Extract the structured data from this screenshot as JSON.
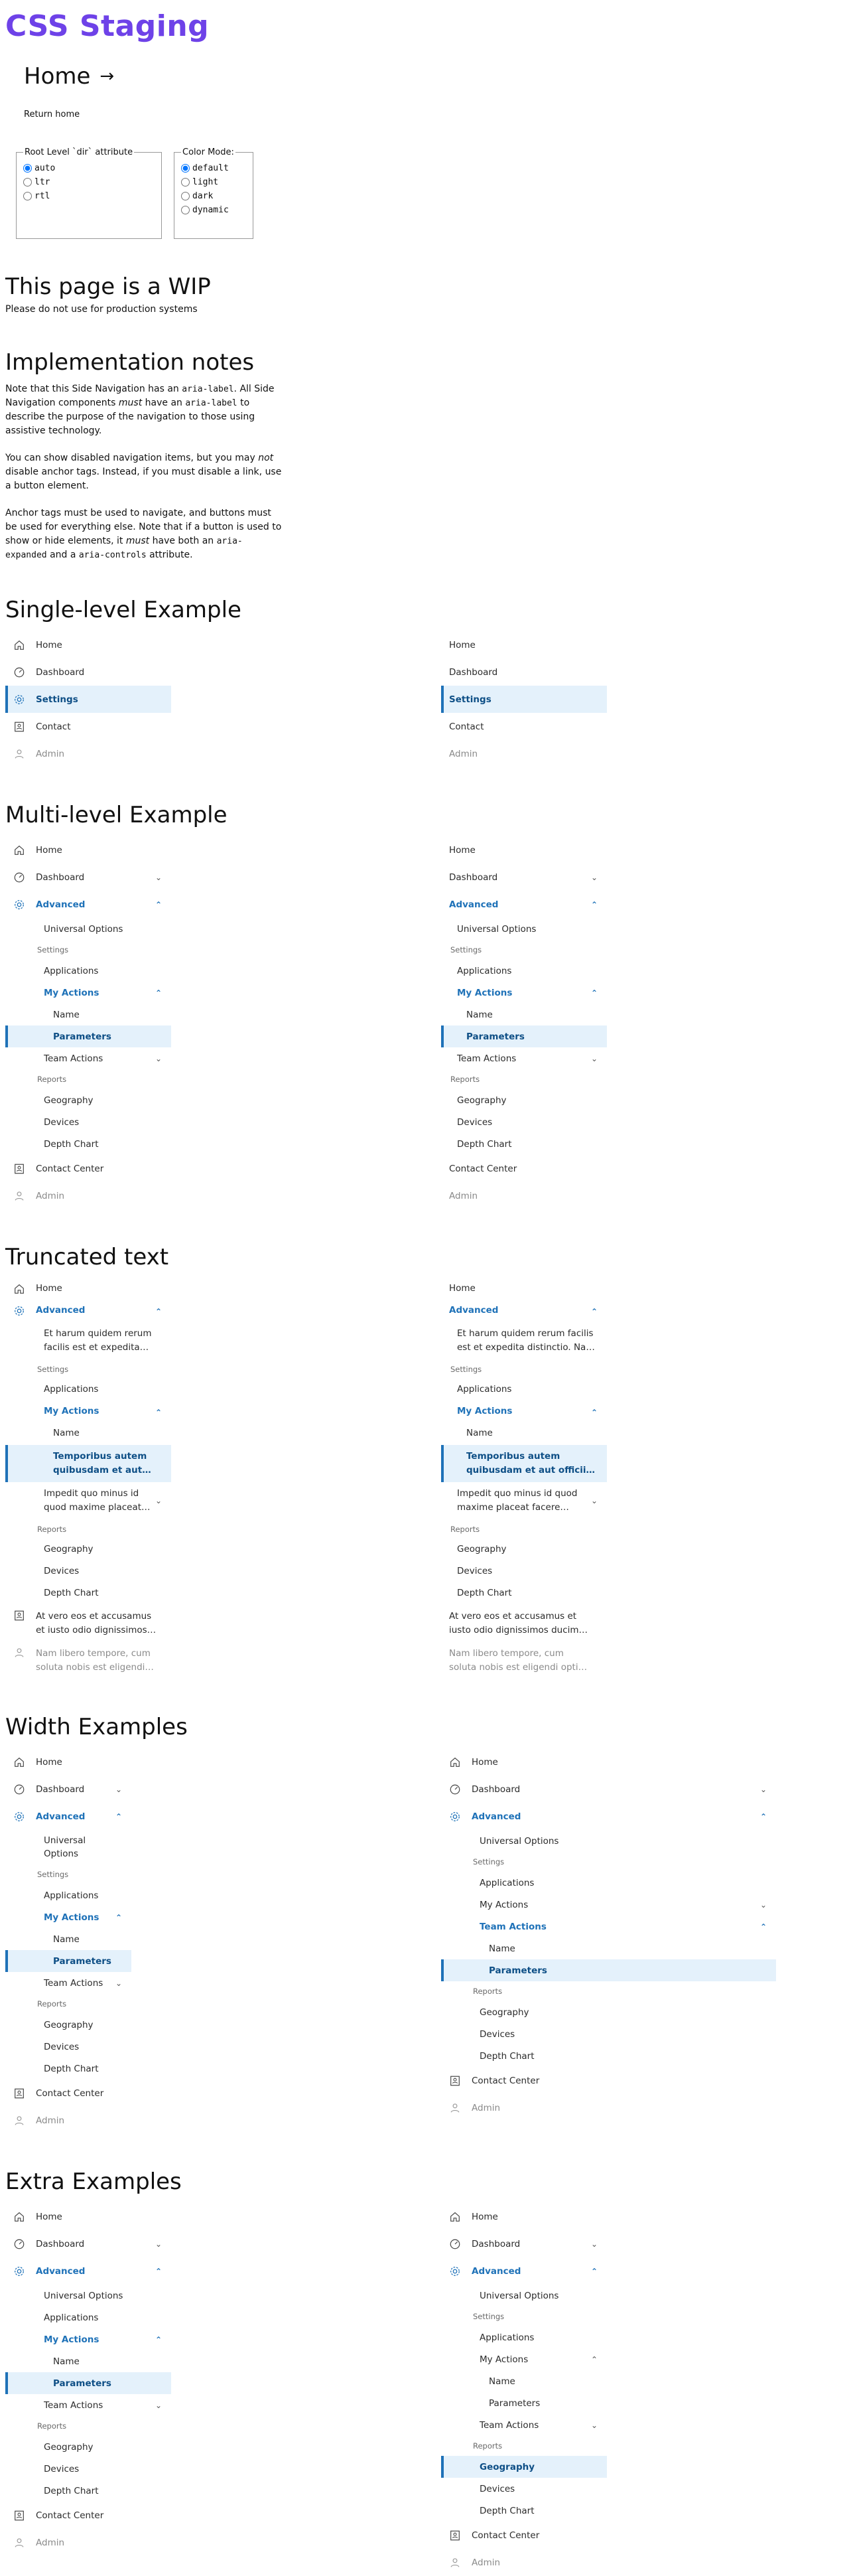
{
  "site": {
    "title": "CSS Staging"
  },
  "header": {
    "home_link": "Home",
    "home_arrow": "→",
    "return_home": "Return home"
  },
  "settings": {
    "dir_legend": "Root Level `dir` attribute",
    "dir_options": [
      "auto",
      "ltr",
      "rtl"
    ],
    "dir_selected": "auto",
    "mode_legend": "Color Mode:",
    "mode_options": [
      "default",
      "light",
      "dark",
      "dynamic"
    ],
    "mode_selected": "default"
  },
  "wip": {
    "title": "This page is a WIP",
    "text": "Please do not use for production systems"
  },
  "notes": {
    "title": "Implementation notes",
    "p1_a": "Note that this Side Navigation has an ",
    "p1_code1": "aria-label",
    "p1_b": ". All Side Navigation components ",
    "p1_em": "must",
    "p1_c": " have an ",
    "p1_code2": "aria-label",
    "p1_d": " to describe the purpose of the navigation to those using assistive technology.",
    "p2_a": "You can show disabled navigation items, but you may ",
    "p2_em": "not",
    "p2_b": " disable anchor tags. Instead, if you must disable a link, use a button element.",
    "p3_a": "Anchor tags must be used to navigate, and buttons must be used for everything else. Note that if a button is used to show or hide elements, it ",
    "p3_em": "must",
    "p3_b": " have both an ",
    "p3_code1": "aria-expanded",
    "p3_c": " and a ",
    "p3_code2": "aria-controls",
    "p3_d": " attribute."
  },
  "sections": {
    "single": "Single-level Example",
    "multi": "Multi-level Example",
    "truncated": "Truncated text",
    "width": "Width Examples",
    "extra": "Extra Examples"
  },
  "labels": {
    "home": "Home",
    "dashboard": "Dashboard",
    "settings": "Settings",
    "contact": "Contact",
    "admin": "Admin",
    "advanced": "Advanced",
    "universal_options": "Universal Options",
    "settings_heading": "Settings",
    "applications": "Applications",
    "my_actions": "My Actions",
    "name": "Name",
    "parameters": "Parameters",
    "team_actions": "Team Actions",
    "reports_heading": "Reports",
    "geography": "Geography",
    "devices": "Devices",
    "depth_chart": "Depth Chart",
    "contact_center": "Contact Center"
  },
  "truncated_text": {
    "advanced_child": "Et harum quidem rerum facilis est et expedita distinctio. Nam libero tempore.",
    "parameters": "Temporibus autem quibusdam et aut officiis debitis aut rerum necessitatibus.",
    "impedit": "Impedit quo minus id quod maxime placeat facere possimus, omnis voluptas.",
    "contact": "At vero eos et accusamus et iusto odio dignissimos ducimus qui blanditiis.",
    "admin": "Nam libero tempore, cum soluta nobis est eligendi optio cumque nihil impedit."
  },
  "colors": {
    "brand": "#6e42e8",
    "active_bg": "#e4f1fb",
    "active_text": "#0e4f86",
    "accent": "#1f72b8"
  },
  "icons": {
    "home": "home-icon",
    "dashboard": "dashboard-icon",
    "settings": "gear-icon",
    "contact": "contact-card-icon",
    "admin": "user-icon"
  }
}
